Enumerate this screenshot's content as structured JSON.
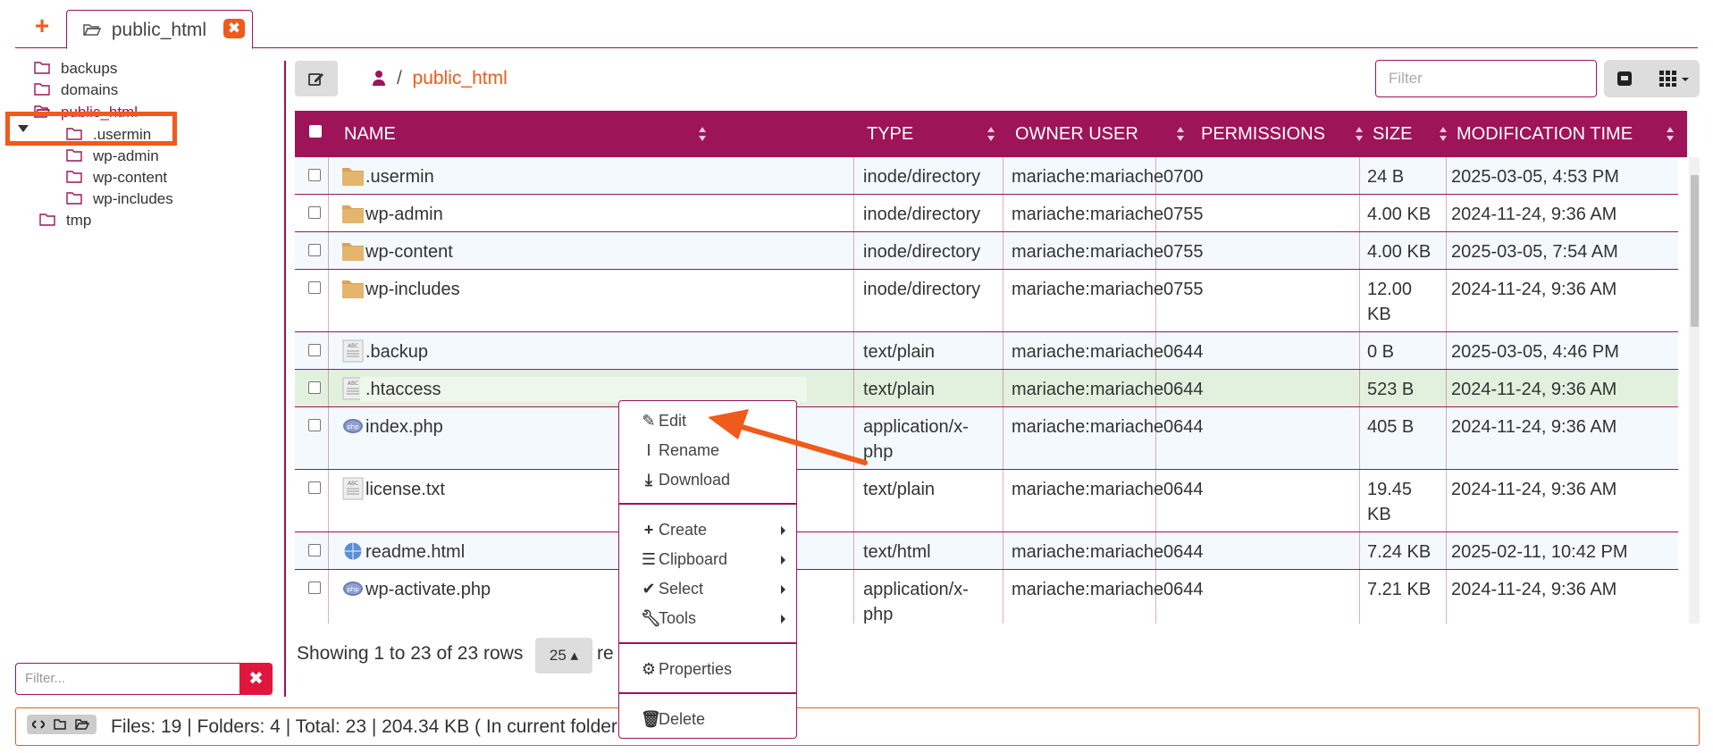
{
  "tabs": {
    "add_label": "+",
    "active_label": "public_html",
    "close_label": "✖"
  },
  "tree": {
    "items": [
      {
        "label": "backups"
      },
      {
        "label": "domains"
      },
      {
        "label": "public_html"
      },
      {
        "label": ".usermin"
      },
      {
        "label": "wp-admin"
      },
      {
        "label": "wp-content"
      },
      {
        "label": "wp-includes"
      },
      {
        "label": "tmp"
      }
    ],
    "filter_placeholder": "Filter...",
    "filter_clear": "✖"
  },
  "breadcrumb": {
    "separator": "/",
    "current": "public_html"
  },
  "filter": {
    "placeholder": "Filter"
  },
  "table": {
    "columns": [
      "NAME",
      "TYPE",
      "OWNER USER",
      "PERMISSIONS",
      "SIZE",
      "MODIFICATION TIME"
    ],
    "rows": [
      {
        "name": ".usermin",
        "type": "inode/directory",
        "owner": "mariache:mariache",
        "perms": "0700",
        "size": "24 B",
        "mtime": "2025-03-05, 4:53 PM",
        "icon": "folder-icon"
      },
      {
        "name": "wp-admin",
        "type": "inode/directory",
        "owner": "mariache:mariache",
        "perms": "0755",
        "size": "4.00 KB",
        "mtime": "2024-11-24, 9:36 AM",
        "icon": "folder-icon"
      },
      {
        "name": "wp-content",
        "type": "inode/directory",
        "owner": "mariache:mariache",
        "perms": "0755",
        "size": "4.00 KB",
        "mtime": "2025-03-05, 7:54 AM",
        "icon": "folder-icon"
      },
      {
        "name": "wp-includes",
        "type": "inode/directory",
        "owner": "mariache:mariache",
        "perms": "0755",
        "size": "12.00",
        "size2": "KB",
        "mtime": "2024-11-24, 9:36 AM",
        "icon": "folder-icon"
      },
      {
        "name": ".backup",
        "type": "text/plain",
        "owner": "mariache:mariache",
        "perms": "0644",
        "size": "0 B",
        "mtime": "2025-03-05, 4:46 PM",
        "icon": "text-file-icon"
      },
      {
        "name": ".htaccess",
        "type": "text/plain",
        "owner": "mariache:mariache",
        "perms": "0644",
        "size": "523 B",
        "mtime": "2024-11-24, 9:36 AM",
        "icon": "text-file-icon"
      },
      {
        "name": "index.php",
        "type": "application/x-",
        "type2": "php",
        "owner": "mariache:mariache",
        "perms": "0644",
        "size": "405 B",
        "mtime": "2024-11-24, 9:36 AM",
        "icon": "php-file-icon"
      },
      {
        "name": "license.txt",
        "type": "text/plain",
        "owner": "mariache:mariache",
        "perms": "0644",
        "size": "19.45",
        "size2": "KB",
        "mtime": "2024-11-24, 9:36 AM",
        "icon": "text-file-icon"
      },
      {
        "name": "readme.html",
        "type": "text/html",
        "owner": "mariache:mariache",
        "perms": "0644",
        "size": "7.24 KB",
        "mtime": "2025-02-11, 10:42 PM",
        "icon": "html-file-icon"
      },
      {
        "name": "wp-activate.php",
        "type": "application/x-",
        "type2": "php",
        "owner": "mariache:mariache",
        "perms": "0644",
        "size": "7.21 KB",
        "mtime": "2024-11-24, 9:36 AM",
        "icon": "php-file-icon"
      }
    ]
  },
  "pager": {
    "showing": "Showing 1 to 23 of 23 rows",
    "page_size": "25",
    "tail": "re"
  },
  "status": {
    "text": "Files: 19 | Folders: 4 | Total: 23 | 204.34 KB ( In current folder )"
  },
  "context_menu": {
    "edit": "Edit",
    "rename": "Rename",
    "download": "Download",
    "create": "Create",
    "clipboard": "Clipboard",
    "select": "Select",
    "tools": "Tools",
    "properties": "Properties",
    "delete": "Delete"
  },
  "colors": {
    "accent": "#9e1458",
    "orange": "#f05a1a",
    "highlight_row": "#e2f1de"
  }
}
